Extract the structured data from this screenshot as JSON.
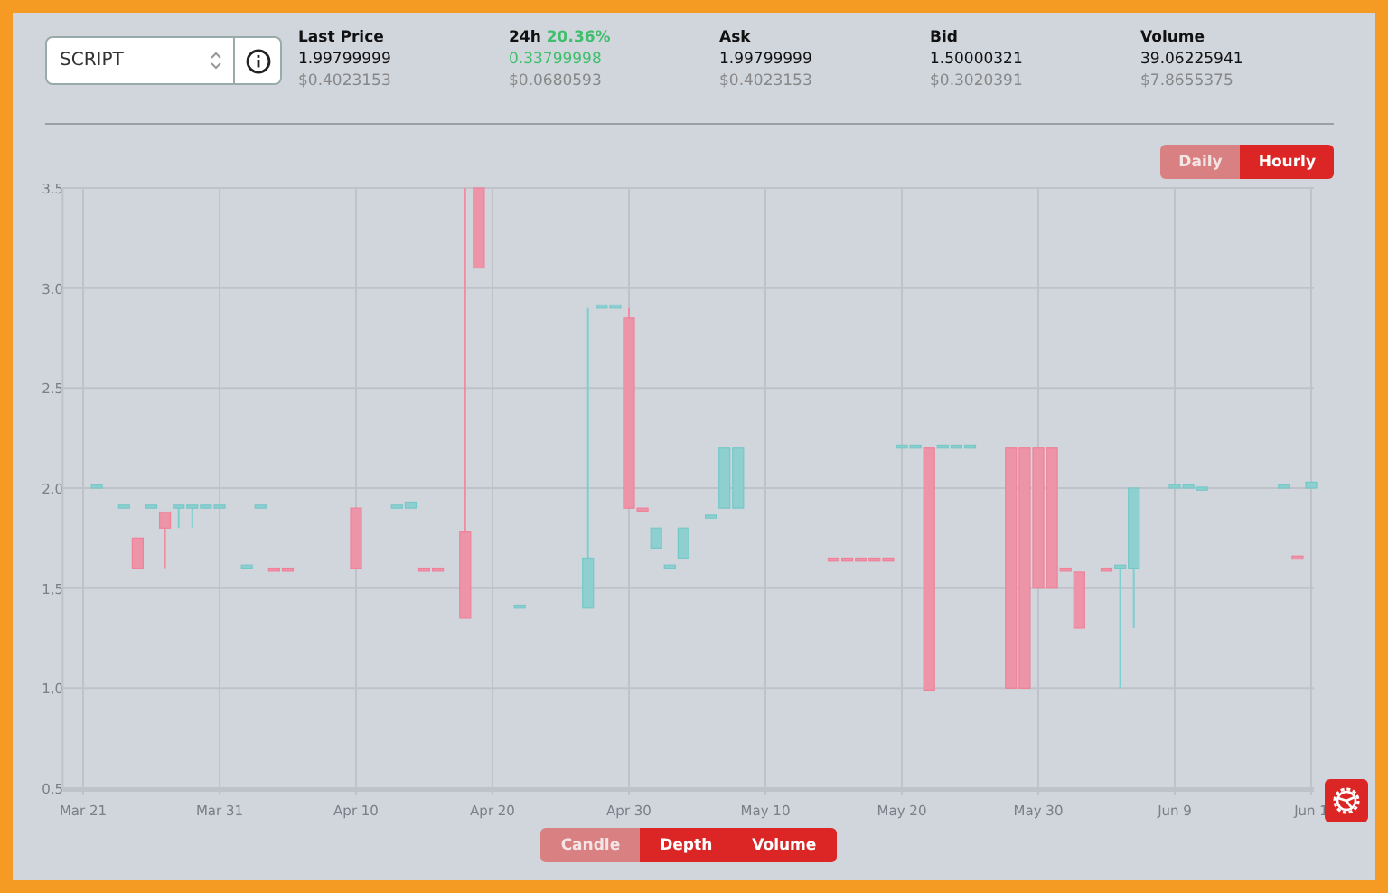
{
  "market_select": {
    "value": "SCRIPT"
  },
  "stats": [
    {
      "kind": "plain",
      "label": "Last Price",
      "value": "1.99799999",
      "usd": "$0.4023153"
    },
    {
      "kind": "change",
      "label": "24h",
      "change": "20.36%",
      "value": "0.33799998",
      "usd": "$0.0680593"
    },
    {
      "kind": "plain",
      "label": "Ask",
      "value": "1.99799999",
      "usd": "$0.4023153"
    },
    {
      "kind": "plain",
      "label": "Bid",
      "value": "1.50000321",
      "usd": "$0.3020391"
    },
    {
      "kind": "plain",
      "label": "Volume",
      "value": "39.06225941",
      "usd": "$7.8655375"
    }
  ],
  "interval_tabs": [
    {
      "label": "Daily",
      "selected": true
    },
    {
      "label": "Hourly",
      "selected": false
    }
  ],
  "chart_data": {
    "type": "candlestick",
    "grid": true,
    "ylim": [
      0.5,
      3.5
    ],
    "yticks": [
      {
        "value": 0.5,
        "label": "0,5"
      },
      {
        "value": 1,
        "label": "1,0"
      },
      {
        "value": 1.5,
        "label": "1,5"
      },
      {
        "value": 2,
        "label": "2.0"
      },
      {
        "value": 2.5,
        "label": "2.5"
      },
      {
        "value": 3,
        "label": "3.0"
      },
      {
        "value": 3.5,
        "label": "3.5"
      }
    ],
    "categories": [
      "Mar 21",
      null,
      null,
      null,
      null,
      null,
      null,
      null,
      null,
      null,
      "Mar 31",
      null,
      null,
      null,
      null,
      null,
      null,
      null,
      null,
      null,
      "Apr 10",
      null,
      null,
      null,
      null,
      null,
      null,
      null,
      null,
      null,
      "Apr 20",
      null,
      null,
      null,
      null,
      null,
      null,
      null,
      null,
      null,
      "Apr 30",
      null,
      null,
      null,
      null,
      null,
      null,
      null,
      null,
      null,
      "May 10",
      null,
      null,
      null,
      null,
      null,
      null,
      null,
      null,
      null,
      "May 20",
      null,
      null,
      null,
      null,
      null,
      null,
      null,
      null,
      null,
      "May 30",
      null,
      null,
      null,
      null,
      null,
      null,
      null,
      null,
      null,
      "Jun 9",
      null,
      null,
      null,
      null,
      null,
      null,
      null,
      null,
      null,
      "Jun 1"
    ],
    "series": [
      {
        "ohlc": [
          null,
          [
            2.0,
            2.015,
            2.0,
            2.015
          ],
          null,
          [
            1.9,
            1.915,
            1.9,
            1.915
          ],
          [
            1.75,
            1.75,
            1.6,
            1.6
          ],
          [
            1.9,
            1.915,
            1.9,
            1.915
          ],
          [
            1.88,
            1.88,
            1.6,
            1.8
          ],
          [
            1.9,
            1.915,
            1.8,
            1.915
          ],
          [
            1.9,
            1.915,
            1.8,
            1.915
          ],
          [
            1.9,
            1.915,
            1.9,
            1.915
          ],
          [
            1.9,
            1.915,
            1.9,
            1.915
          ],
          null,
          [
            1.6,
            1.615,
            1.6,
            1.615
          ],
          [
            1.9,
            1.915,
            1.9,
            1.915
          ],
          [
            1.6,
            1.6,
            1.585,
            1.585
          ],
          [
            1.6,
            1.6,
            1.585,
            1.585
          ],
          null,
          null,
          null,
          null,
          [
            1.9,
            1.9,
            1.6,
            1.6
          ],
          null,
          null,
          [
            1.9,
            1.915,
            1.9,
            1.915
          ],
          [
            1.9,
            1.93,
            1.9,
            1.93
          ],
          [
            1.6,
            1.6,
            1.585,
            1.585
          ],
          [
            1.6,
            1.6,
            1.585,
            1.585
          ],
          null,
          [
            1.78,
            3.5,
            1.35,
            1.35
          ],
          [
            3.5,
            3.5,
            3.1,
            3.1
          ],
          null,
          null,
          [
            1.4,
            1.415,
            1.4,
            1.415
          ],
          null,
          null,
          null,
          null,
          [
            1.4,
            2.9,
            1.4,
            1.65
          ],
          [
            2.9,
            2.915,
            2.9,
            2.915
          ],
          [
            2.9,
            2.915,
            2.9,
            2.915
          ],
          [
            2.85,
            2.9,
            1.9,
            1.9
          ],
          [
            1.9,
            1.9,
            1.885,
            1.885
          ],
          [
            1.7,
            1.8,
            1.7,
            1.8
          ],
          [
            1.6,
            1.615,
            1.6,
            1.615
          ],
          [
            1.65,
            1.8,
            1.65,
            1.8
          ],
          null,
          [
            1.85,
            1.865,
            1.85,
            1.865
          ],
          [
            1.9,
            2.2,
            1.9,
            2.2
          ],
          [
            1.9,
            2.2,
            1.9,
            2.2
          ],
          null,
          null,
          null,
          null,
          null,
          null,
          [
            1.65,
            1.65,
            1.635,
            1.635
          ],
          [
            1.65,
            1.65,
            1.635,
            1.635
          ],
          [
            1.65,
            1.65,
            1.635,
            1.635
          ],
          [
            1.65,
            1.65,
            1.635,
            1.635
          ],
          [
            1.65,
            1.65,
            1.635,
            1.635
          ],
          [
            2.2,
            2.215,
            2.2,
            2.215
          ],
          [
            2.2,
            2.215,
            2.2,
            2.215
          ],
          [
            2.2,
            2.2,
            0.99,
            0.99
          ],
          [
            2.2,
            2.215,
            2.2,
            2.215
          ],
          [
            2.2,
            2.215,
            2.2,
            2.215
          ],
          [
            2.2,
            2.215,
            2.2,
            2.215
          ],
          null,
          null,
          [
            2.2,
            2.2,
            1.0,
            1.0
          ],
          [
            2.2,
            2.2,
            1.0,
            1.0
          ],
          [
            2.2,
            2.2,
            1.5,
            1.5
          ],
          [
            2.2,
            2.2,
            1.5,
            1.5
          ],
          [
            1.6,
            1.6,
            1.585,
            1.585
          ],
          [
            1.58,
            1.58,
            1.3,
            1.3
          ],
          null,
          [
            1.6,
            1.6,
            1.585,
            1.585
          ],
          [
            1.6,
            1.615,
            1.0,
            1.615
          ],
          [
            1.6,
            2.0,
            1.3,
            2.0
          ],
          null,
          null,
          [
            2.0,
            2.015,
            2.0,
            2.015
          ],
          [
            2.0,
            2.015,
            2.0,
            2.015
          ],
          [
            1.99,
            2.005,
            1.99,
            2.005
          ],
          null,
          null,
          null,
          null,
          null,
          [
            2.0,
            2.015,
            2.0,
            2.015
          ],
          [
            1.66,
            1.66,
            1.645,
            1.645
          ],
          [
            2.0,
            2.03,
            2.0,
            2.03
          ]
        ]
      }
    ]
  },
  "view_tabs": [
    {
      "label": "Candle",
      "selected": true
    },
    {
      "label": "Depth",
      "selected": false
    },
    {
      "label": "Volume",
      "selected": false
    }
  ]
}
